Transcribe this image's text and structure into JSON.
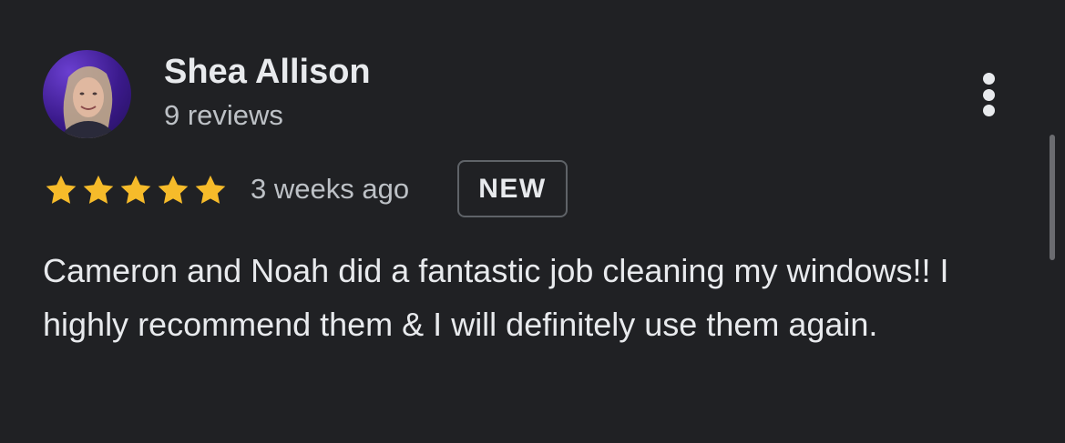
{
  "review": {
    "reviewer_name": "Shea Allison",
    "review_count": "9 reviews",
    "rating": 5,
    "rating_max": 5,
    "time_ago": "3 weeks ago",
    "badge": "NEW",
    "text": "Cameron and Noah did a fantastic job cleaning my windows!! I highly recommend them & I will definitely use them again.",
    "avatar_icon": "avatar-photo",
    "menu_icon": "more-vert-icon"
  },
  "colors": {
    "background": "#202124",
    "star": "#f6bb2a",
    "primary_text": "#e8eaed",
    "secondary_text": "#bdc1c6",
    "badge_border": "#5f6368"
  }
}
